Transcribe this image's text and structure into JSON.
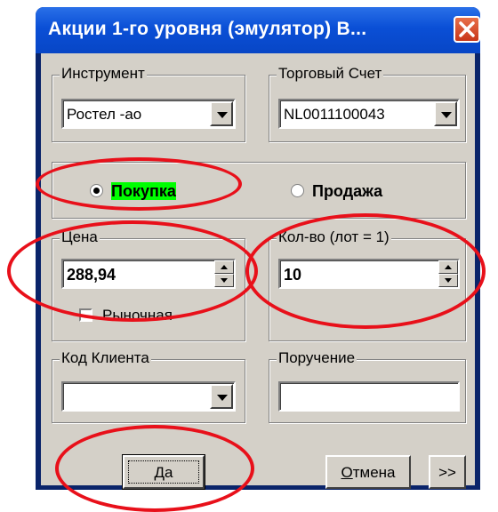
{
  "window": {
    "title": "Акции 1-го уровня (эмулятор) В..."
  },
  "instrument": {
    "label": "Инструмент",
    "value": "Ростел -ао"
  },
  "account": {
    "label": "Торговый Счет",
    "value": "NL0011100043"
  },
  "side": {
    "buy_label": "Покупка",
    "sell_label": "Продажа",
    "selected": "buy"
  },
  "price": {
    "label": "Цена",
    "value": "288,94"
  },
  "market": {
    "label": "Рыночная",
    "checked": false
  },
  "quantity": {
    "label": "Кол-во (лот = 1)",
    "value": "10"
  },
  "client_code": {
    "label": "Код Клиента",
    "value": ""
  },
  "order_ref": {
    "label": "Поручение",
    "value": ""
  },
  "buttons": {
    "ok_prefix": "",
    "ok_underline": "Д",
    "ok_rest": "а",
    "cancel_underline": "О",
    "cancel_rest": "тмена",
    "more": ">>"
  },
  "annotation_color": "#e8101a"
}
